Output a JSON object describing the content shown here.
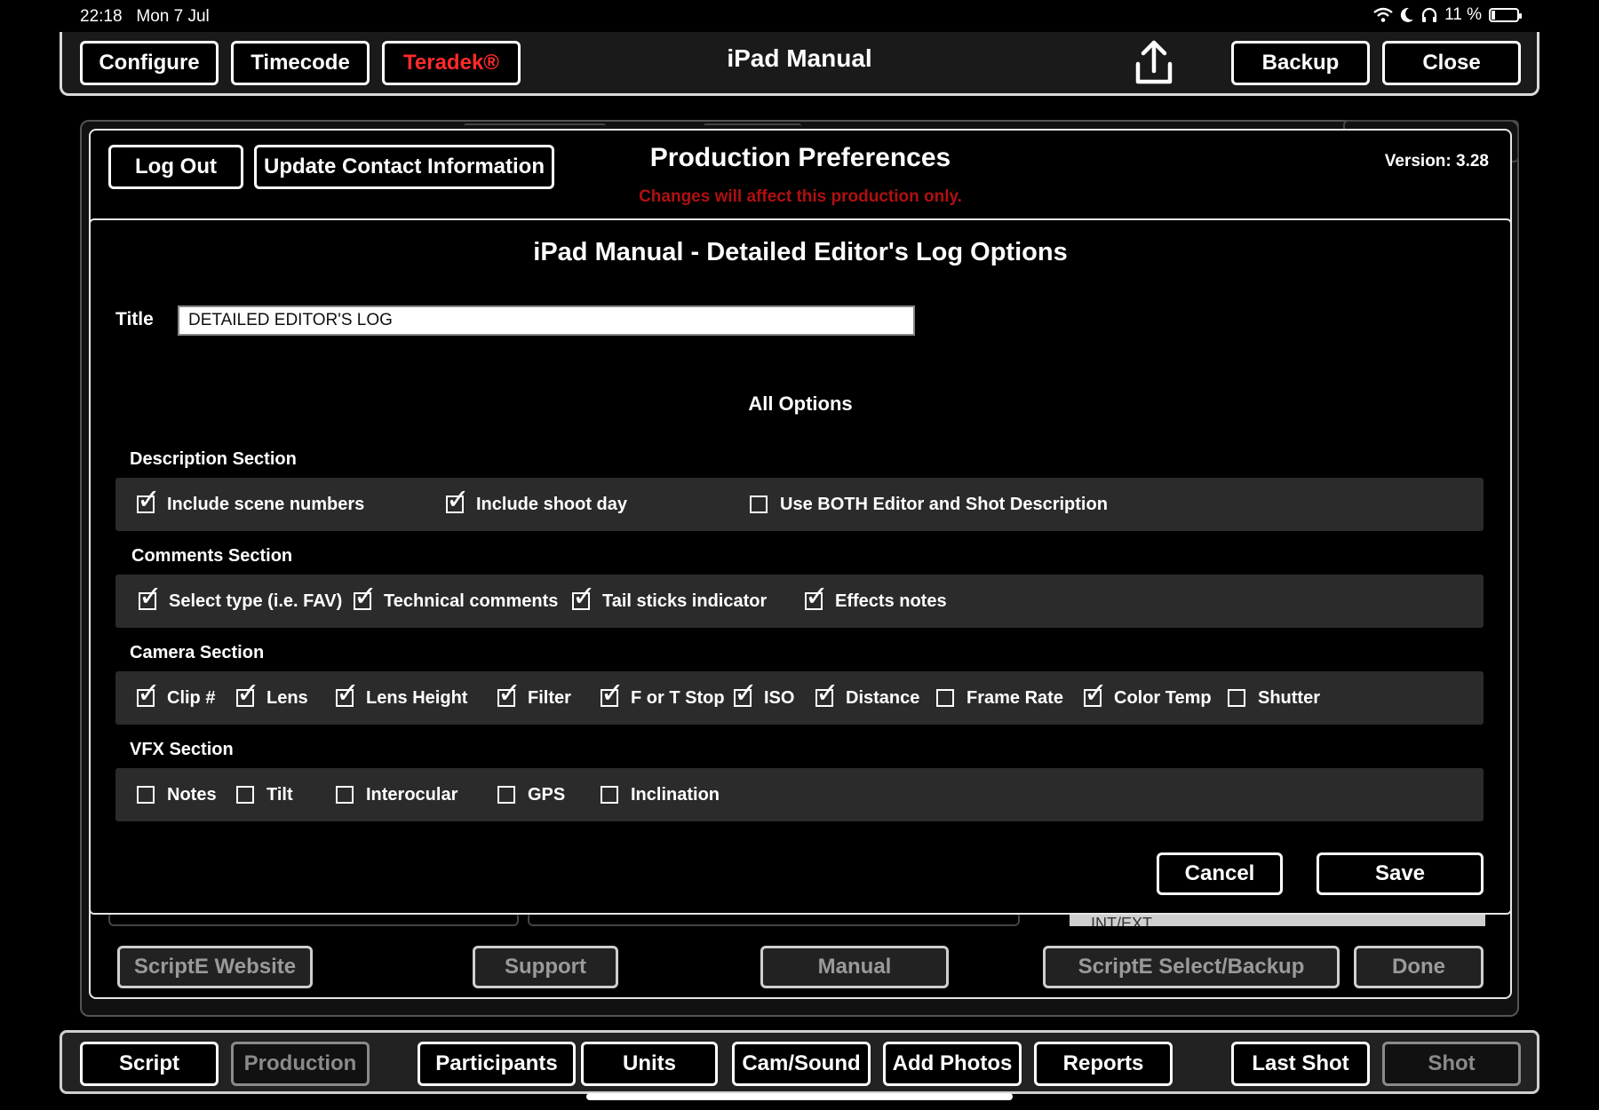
{
  "status_bar": {
    "time": "22:18",
    "date": "Mon 7 Jul",
    "battery": "11 %"
  },
  "top_bar": {
    "configure": "Configure",
    "timecode": "Timecode",
    "teradek": "Teradek®",
    "title": "iPad Manual",
    "backup": "Backup",
    "close": "Close"
  },
  "prefs": {
    "log_out": "Log Out",
    "update_contact": "Update Contact Information",
    "title": "Production Preferences",
    "warning": "Changes will affect this production only.",
    "version": "Version: 3.28",
    "bottom_partial": "INT/EXT"
  },
  "dialog": {
    "title": "iPad Manual - Detailed Editor's Log Options",
    "title_label": "Title",
    "title_value": "DETAILED EDITOR'S LOG",
    "all_options": "All Options",
    "sections": {
      "description": {
        "label": "Description Section",
        "options": [
          {
            "label": "Include scene numbers",
            "checked": true
          },
          {
            "label": "Include shoot day",
            "checked": true
          },
          {
            "label": "Use BOTH Editor and Shot Description",
            "checked": false
          }
        ]
      },
      "comments": {
        "label": "Comments Section",
        "options": [
          {
            "label": "Select type (i.e. FAV)",
            "checked": true
          },
          {
            "label": "Technical comments",
            "checked": true
          },
          {
            "label": "Tail sticks indicator",
            "checked": true
          },
          {
            "label": "Effects notes",
            "checked": true
          }
        ]
      },
      "camera": {
        "label": "Camera Section",
        "options": [
          {
            "label": "Clip #",
            "checked": true
          },
          {
            "label": "Lens",
            "checked": true
          },
          {
            "label": "Lens Height",
            "checked": true
          },
          {
            "label": "Filter",
            "checked": true
          },
          {
            "label": "F or T Stop",
            "checked": true
          },
          {
            "label": "ISO",
            "checked": true
          },
          {
            "label": "Distance",
            "checked": true
          },
          {
            "label": "Frame Rate",
            "checked": false
          },
          {
            "label": "Color Temp",
            "checked": true
          },
          {
            "label": "Shutter",
            "checked": false
          }
        ]
      },
      "vfx": {
        "label": "VFX Section",
        "options": [
          {
            "label": "Notes",
            "checked": false
          },
          {
            "label": "Tilt",
            "checked": false
          },
          {
            "label": "Interocular",
            "checked": false
          },
          {
            "label": "GPS",
            "checked": false
          },
          {
            "label": "Inclination",
            "checked": false
          }
        ]
      }
    },
    "cancel": "Cancel",
    "save": "Save"
  },
  "lower_buttons": {
    "scripte_website": "ScriptE Website",
    "support": "Support",
    "manual": "Manual",
    "scripte_select": "ScriptE Select/Backup",
    "done": "Done"
  },
  "bottom_tabs": [
    "Script",
    "Production",
    "Participants",
    "Units",
    "Cam/Sound",
    "Add Photos",
    "Reports",
    "Last Shot",
    "Shot"
  ],
  "colors": {
    "accent_red": "#ff2a2a",
    "warning_red": "#b01010",
    "row_bg": "#2b2b2b"
  }
}
